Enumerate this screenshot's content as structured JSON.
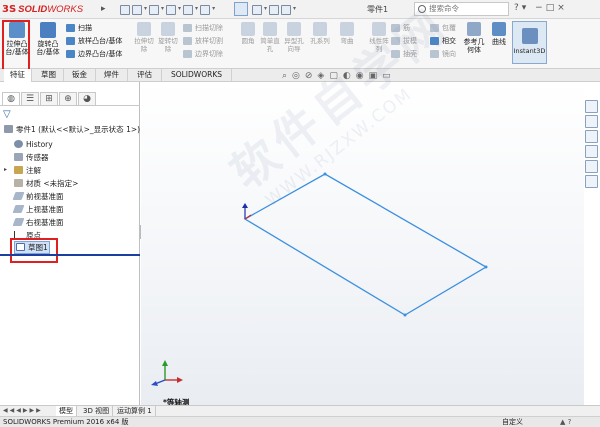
{
  "app": {
    "logo_prefix": "3S",
    "logo_brand_bold": "SOLID",
    "logo_brand_rest": "WORKS",
    "document_name": "零件1",
    "search_placeholder": "搜索命令"
  },
  "ribbon": {
    "extrude_boss": "拉伸凸台/基体",
    "revolve_boss": "旋转凸台/基体",
    "sweep": "扫描",
    "loft": "放样凸台/基体",
    "boundary": "边界凸台/基体",
    "extrude_cut": "拉伸切除",
    "revolve_cut": "旋转切除",
    "swept_cut": "扫描切除",
    "lofted_cut": "放样切割",
    "boundary_cut": "边界切除",
    "fillet": "圆角",
    "linear_pattern": "线性阵列",
    "rib": "筋",
    "draft": "拔模",
    "shell": "抽壳",
    "wrap": "包覆",
    "intersect": "相交",
    "mirror": "镜向",
    "ref_geometry": "参考几何体",
    "curves": "曲线",
    "instant3d": "Instant3D",
    "hole_wizard": "异型孔向导",
    "simple_hole": "简单直孔",
    "hole_series": "孔系列",
    "dome": "弯曲"
  },
  "tabs": [
    {
      "label": "特征"
    },
    {
      "label": "草图"
    },
    {
      "label": "钣金"
    },
    {
      "label": "焊件"
    },
    {
      "label": "评估"
    },
    {
      "label": "SOLIDWORKS MBD"
    }
  ],
  "tree": {
    "root": "零件1  (默认<<默认>_显示状态 1>)",
    "items": [
      {
        "label": "History"
      },
      {
        "label": "传感器"
      },
      {
        "label": "注解"
      },
      {
        "label": "材质 <未指定>"
      },
      {
        "label": "前视基准面"
      },
      {
        "label": "上视基准面"
      },
      {
        "label": "右视基准面"
      },
      {
        "label": "原点"
      },
      {
        "label": "草图1"
      }
    ]
  },
  "viewport": {
    "view_label": "*等轴测",
    "watermark_text": "软件自学网",
    "watermark_url": "WWW.RJZXW.COM"
  },
  "bottom_tabs": [
    {
      "label": "模型"
    },
    {
      "label": "3D 视图"
    },
    {
      "label": "运动算例 1"
    }
  ],
  "status": {
    "product": "SOLIDWORKS Premium 2016 x64 版",
    "custom": "自定义"
  },
  "colors": {
    "sketch_line": "#3b8fe0",
    "highlight_frame": "#e02020",
    "brand_red": "#d62020"
  }
}
